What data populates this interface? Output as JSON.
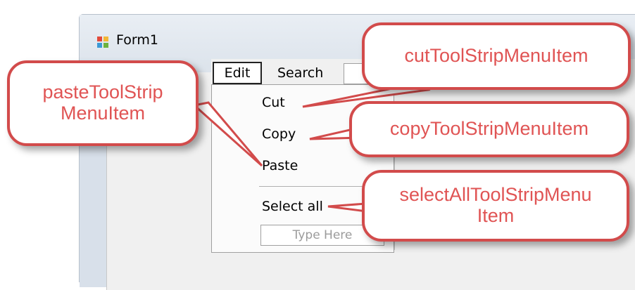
{
  "window": {
    "title": "Form1"
  },
  "menu": {
    "edit_label": "Edit",
    "search_label": "Search"
  },
  "dropdown": {
    "items": [
      {
        "label": "Cut"
      },
      {
        "label": "Copy"
      },
      {
        "label": "Paste"
      },
      {
        "label": "Select all"
      }
    ],
    "type_here_placeholder": "Type Here"
  },
  "callouts": {
    "cut": "cutToolStripMenuItem",
    "copy": "copyToolStripMenuItem",
    "paste_line1": "pasteToolStrip",
    "paste_line2": "MenuItem",
    "select_all_line1": "selectAllToolStripMenu",
    "select_all_line2": "Item"
  },
  "colors": {
    "callout_text": "#e05454",
    "callout_border": "#d24b4b"
  }
}
